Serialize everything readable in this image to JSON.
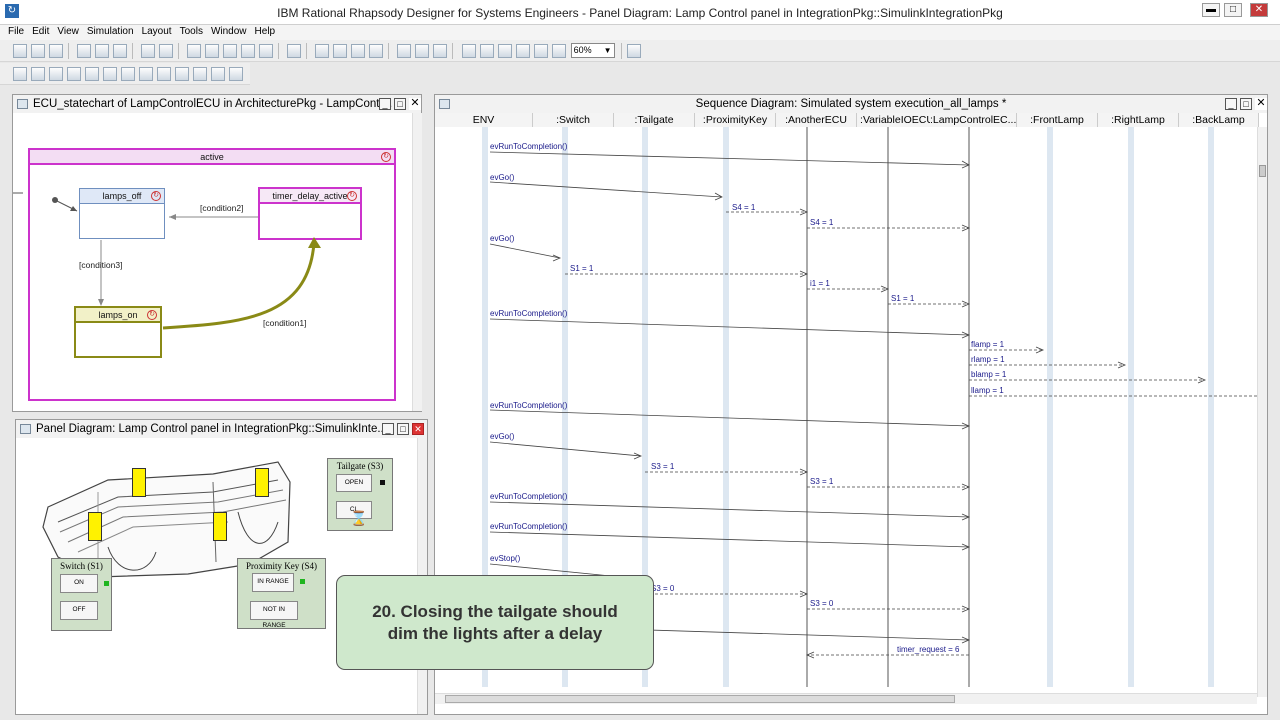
{
  "app": {
    "title": "IBM Rational Rhapsody Designer for Systems Engineers - Panel Diagram: Lamp Control panel in IntegrationPkg::SimulinkIntegrationPkg"
  },
  "menu": [
    "File",
    "Edit",
    "View",
    "Simulation",
    "Layout",
    "Tools",
    "Window",
    "Help"
  ],
  "toolbar": {
    "zoom_value": "60%"
  },
  "statechart": {
    "title": "ECU_statechart of LampControlECU in ArchitecturePkg - LampContr...",
    "states": {
      "active": "active",
      "lamps_off": "lamps_off",
      "timer_delay_active": "timer_delay_active",
      "lamps_on": "lamps_on"
    },
    "transitions": {
      "c1": "[condition1]",
      "c2": "[condition2]",
      "c3": "[condition3]"
    }
  },
  "panel_diagram": {
    "title": "Panel Diagram: Lamp Control panel in IntegrationPkg::SimulinkInte...",
    "tailgate": {
      "title": "Tailgate (S3)",
      "open": "OPEN",
      "close": "CL"
    },
    "switch": {
      "title": "Switch (S1)",
      "on": "ON",
      "off": "OFF"
    },
    "proximity": {
      "title": "Proximity Key (S4)",
      "in_range": "IN RANGE",
      "not_in_range": "NOT IN RANGE"
    }
  },
  "sequence": {
    "title": "Sequence Diagram: Simulated system execution_all_lamps *",
    "lifelines": [
      "ENV",
      ":Switch",
      ":Tailgate",
      ":ProximityKey",
      ":AnotherECU",
      ":VariableIOECU",
      ":LampControlEC...",
      ":FrontLamp",
      ":RightLamp",
      ":BackLamp"
    ],
    "messages": [
      {
        "label": "evRunToCompletion()"
      },
      {
        "label": "evGo()"
      },
      {
        "label": "S4 = 1"
      },
      {
        "label": "S4 = 1"
      },
      {
        "label": "evGo()"
      },
      {
        "label": "S1 = 1"
      },
      {
        "label": "i1 = 1"
      },
      {
        "label": "S1 = 1"
      },
      {
        "label": "evRunToCompletion()"
      },
      {
        "label": "flamp = 1"
      },
      {
        "label": "rlamp = 1"
      },
      {
        "label": "blamp = 1"
      },
      {
        "label": "llamp = 1"
      },
      {
        "label": "evRunToCompletion()"
      },
      {
        "label": "evGo()"
      },
      {
        "label": "S3 = 1"
      },
      {
        "label": "S3 = 1"
      },
      {
        "label": "evRunToCompletion()"
      },
      {
        "label": "evRunToCompletion()"
      },
      {
        "label": "evStop()"
      },
      {
        "label": "S3 = 0"
      },
      {
        "label": "S3 = 0"
      },
      {
        "label": "timer_request = 6"
      }
    ]
  },
  "caption": {
    "line1": "20. Closing the tailgate should",
    "line2": "dim the lights after a delay"
  }
}
